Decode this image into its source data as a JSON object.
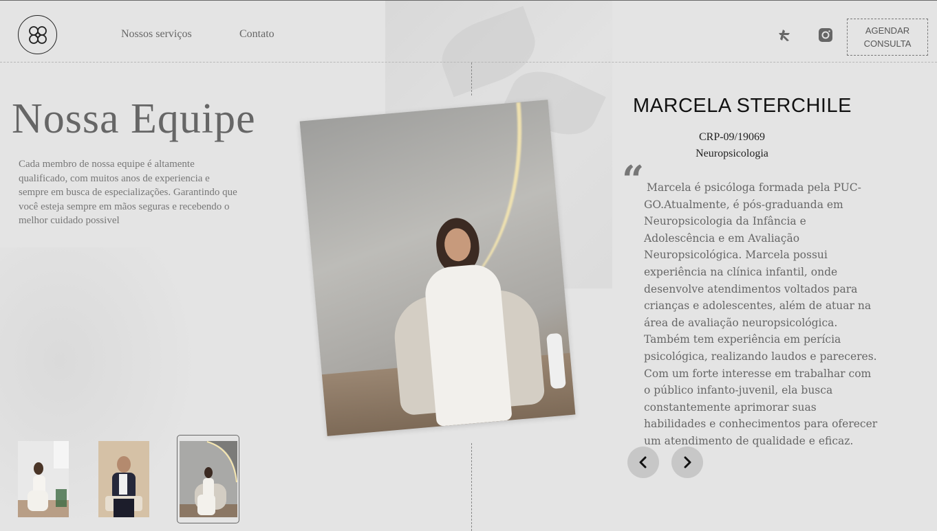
{
  "header": {
    "logo_icon": "knot-flower-logo",
    "nav": [
      {
        "label": "Nossos serviços"
      },
      {
        "label": "Contato"
      }
    ],
    "social": [
      {
        "icon": "doctoralia-icon"
      },
      {
        "icon": "instagram-icon"
      }
    ],
    "cta_label": "AGENDAR CONSULTA"
  },
  "team": {
    "title": "Nossa Equipe",
    "intro": "Cada membro de nossa equipe é altamente qualificado, com muitos anos de experiencia e sempre em busca de especializações. Garantindo que você esteja sempre em mãos seguras e recebendo o melhor cuidado possivel",
    "thumbnails": [
      {
        "selected": false
      },
      {
        "selected": false
      },
      {
        "selected": true
      }
    ]
  },
  "member": {
    "name": "MARCELA STERCHILE",
    "crp": "CRP-09/19069",
    "specialty": "Neuropsicologia",
    "quote_mark": "“",
    "bio": "Marcela é psicóloga formada pela PUC-GO.Atualmente, é pós-graduanda em Neuropsicologia da Infância e Adolescência e em Avaliação Neuropsicológica. Marcela possui experiência na clínica infantil, onde desenvolve atendimentos voltados para crianças e adolescentes, além de atuar na área de avaliação neuropsicológica. Também tem experiência em perícia psicológica, realizando laudos e pareceres. Com um forte interesse em trabalhar com o público infanto-juvenil, ela busca constantemente aprimorar suas habilidades e conhecimentos para oferecer um atendimento de qualidade e eficaz."
  },
  "controls": {
    "prev_icon": "chevron-left-icon",
    "next_icon": "chevron-right-icon"
  },
  "colors": {
    "background": "#e4e4e4",
    "text_muted": "#666666",
    "button_bg": "#c7c7c7"
  }
}
